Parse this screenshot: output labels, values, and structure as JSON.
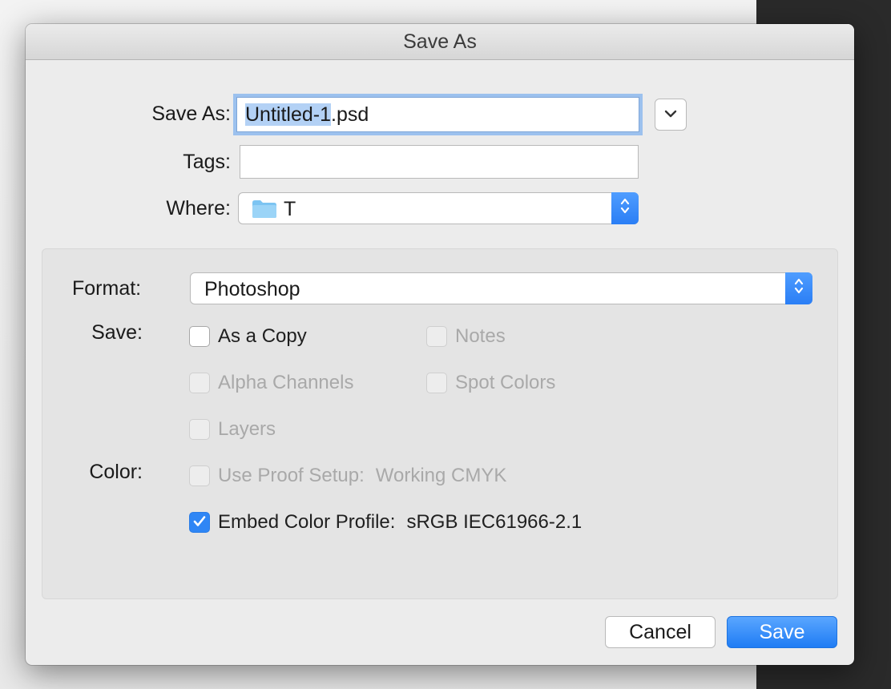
{
  "dialog": {
    "title": "Save As"
  },
  "form": {
    "save_as_label": "Save As:",
    "filename_selected": "Untitled-1",
    "filename_rest": ".psd",
    "tags_label": "Tags:",
    "tags_value": "",
    "where_label": "Where:",
    "where_value": "T"
  },
  "options": {
    "format_label": "Format:",
    "format_value": "Photoshop",
    "save_label": "Save:",
    "color_label": "Color:",
    "as_a_copy": "As a Copy",
    "notes": "Notes",
    "alpha_channels": "Alpha Channels",
    "spot_colors": "Spot Colors",
    "layers": "Layers",
    "use_proof_setup": "Use Proof Setup:",
    "proof_profile": "Working CMYK",
    "embed_color_profile": "Embed Color Profile:",
    "embed_profile": "sRGB IEC61966-2.1"
  },
  "buttons": {
    "cancel": "Cancel",
    "save": "Save"
  },
  "colors": {
    "accent": "#2f86f5",
    "folder": "#8fcdf5",
    "selection": "#b3d1f5"
  }
}
